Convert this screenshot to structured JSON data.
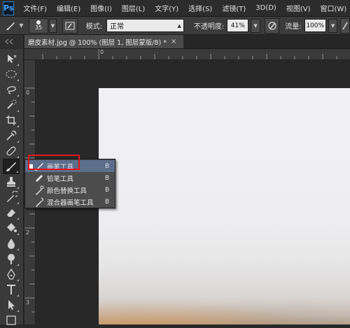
{
  "app": {
    "logo": "Ps"
  },
  "menu": [
    "文件(F)",
    "编辑(E)",
    "图像(I)",
    "图层(L)",
    "文字(Y)",
    "选择(S)",
    "滤镜(T)",
    "3D(D)",
    "视图(V)",
    "窗口(W)"
  ],
  "options": {
    "brush_size": "35",
    "mode_label": "模式:",
    "mode_value": "正常",
    "opacity_label": "不透明度:",
    "opacity_value": "41%",
    "flow_label": "流量:",
    "flow_value": "100%"
  },
  "document_tab": {
    "title": "磨皮素材.jpg @ 100% (图层 1, 图层蒙版/8) *",
    "close": "×"
  },
  "rulers": {
    "top": [
      "0"
    ],
    "left": [
      "0",
      "1",
      "2",
      "3"
    ]
  },
  "toolbar": {
    "tools": [
      "move-icon",
      "marquee-icon",
      "lasso-icon",
      "quick-select-icon",
      "crop-icon",
      "eyedropper-icon",
      "spot-healing-icon",
      "brush-icon",
      "clone-stamp-icon",
      "history-brush-icon",
      "eraser-icon",
      "paint-bucket-icon",
      "blur-icon",
      "dodge-icon",
      "pen-icon",
      "type-icon",
      "path-select-icon"
    ],
    "active_tool": "brush-icon"
  },
  "flyout": {
    "items": [
      {
        "label": "画笔工具",
        "key": "B",
        "icon": "brush-icon",
        "selected": true
      },
      {
        "label": "铅笔工具",
        "key": "B",
        "icon": "pencil-icon",
        "selected": false
      },
      {
        "label": "颜色替换工具",
        "key": "B",
        "icon": "color-replacement-icon",
        "selected": false
      },
      {
        "label": "混合器画笔工具",
        "key": "B",
        "icon": "mixer-brush-icon",
        "selected": false
      }
    ]
  },
  "colors": {
    "highlight_box": "#e0161a",
    "selected_item": "#5b6e8c",
    "logo_blue": "#45a4ff"
  }
}
